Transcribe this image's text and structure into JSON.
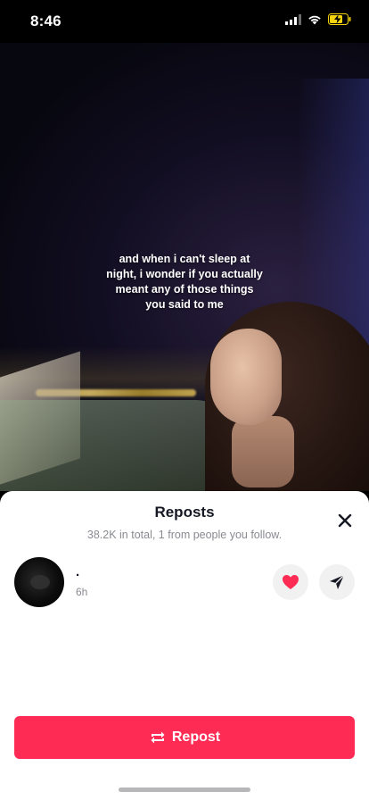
{
  "status_bar": {
    "time": "8:46",
    "signal_icon": "cellular-signal-icon",
    "wifi_icon": "wifi-icon",
    "battery_icon": "battery-charging-icon",
    "battery_color": "#f5d30c"
  },
  "video": {
    "caption_lines": [
      "and when i can't sleep at",
      "night, i wonder if you actually",
      "meant any of those things",
      "you said to me"
    ]
  },
  "sheet": {
    "title": "Reposts",
    "subtitle": "38.2K in total, 1 from people you follow.",
    "close_icon": "close-icon",
    "reposts": [
      {
        "name": ".",
        "time": "6h",
        "like_icon": "heart-icon",
        "send_icon": "send-icon"
      }
    ],
    "repost_button": {
      "label": "Repost",
      "icon": "repost-icon",
      "color": "#fe2c55"
    }
  },
  "colors": {
    "accent": "#fe2c55",
    "heart": "#fe2c55"
  }
}
